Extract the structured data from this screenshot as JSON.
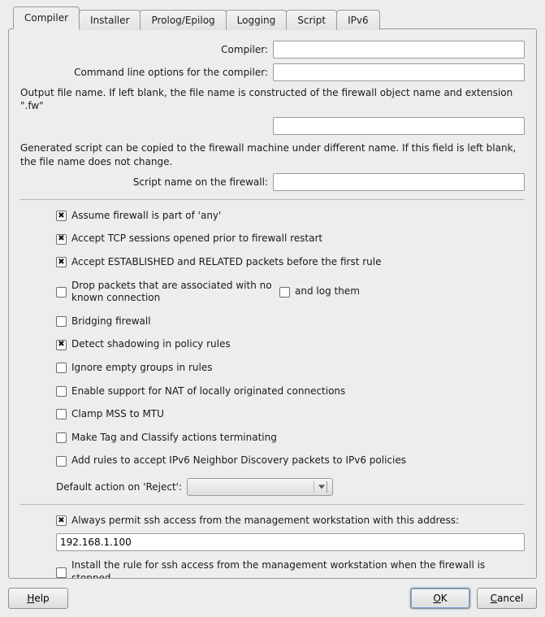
{
  "tabs": [
    "Compiler",
    "Installer",
    "Prolog/Epilog",
    "Logging",
    "Script",
    "IPv6"
  ],
  "active_tab": 0,
  "fields": {
    "compiler_label": "Compiler:",
    "compiler_value": "",
    "cmdline_label": "Command line options for the compiler:",
    "cmdline_value": "",
    "outputfile_note": "Output file name. If left blank, the file name is constructed of the firewall object name and extension \".fw\"",
    "outputfile_value": "",
    "genscript_note": "Generated script can be copied to the firewall machine under different name. If this field is left blank, the file name does not change.",
    "scriptname_label": "Script name on the firewall:",
    "scriptname_value": ""
  },
  "options": {
    "assume_any": {
      "label": "Assume firewall is part of 'any'",
      "checked": true
    },
    "accept_tcp": {
      "label": "Accept TCP sessions opened prior to firewall restart",
      "checked": true
    },
    "accept_est": {
      "label": "Accept ESTABLISHED and RELATED packets before the first rule",
      "checked": true
    },
    "drop_unknown": {
      "label": "Drop packets that are associated with no known connection",
      "checked": false
    },
    "and_log": {
      "label": "and log them",
      "checked": false
    },
    "bridging": {
      "label": "Bridging firewall",
      "checked": false
    },
    "shadowing": {
      "label": "Detect shadowing in policy rules",
      "checked": true
    },
    "ignore_empty": {
      "label": "Ignore empty groups in rules",
      "checked": false
    },
    "nat_local": {
      "label": "Enable support for NAT of locally originated connections",
      "checked": false
    },
    "clamp_mss": {
      "label": "Clamp MSS to MTU",
      "checked": false
    },
    "tag_term": {
      "label": "Make Tag and Classify actions terminating",
      "checked": false
    },
    "ipv6_nd": {
      "label": "Add rules to accept IPv6 Neighbor Discovery packets to IPv6 policies",
      "checked": false
    }
  },
  "reject": {
    "label": "Default action on 'Reject':",
    "value": ""
  },
  "ssh": {
    "permit": {
      "label": "Always permit ssh access from the management workstation with this address:",
      "checked": true
    },
    "address": "192.168.1.100",
    "install_rule": {
      "label": "Install the rule for ssh access from the management workstation when the firewall is stopped",
      "checked": false
    }
  },
  "buttons": {
    "help": "Help",
    "ok": "OK",
    "cancel": "Cancel"
  }
}
